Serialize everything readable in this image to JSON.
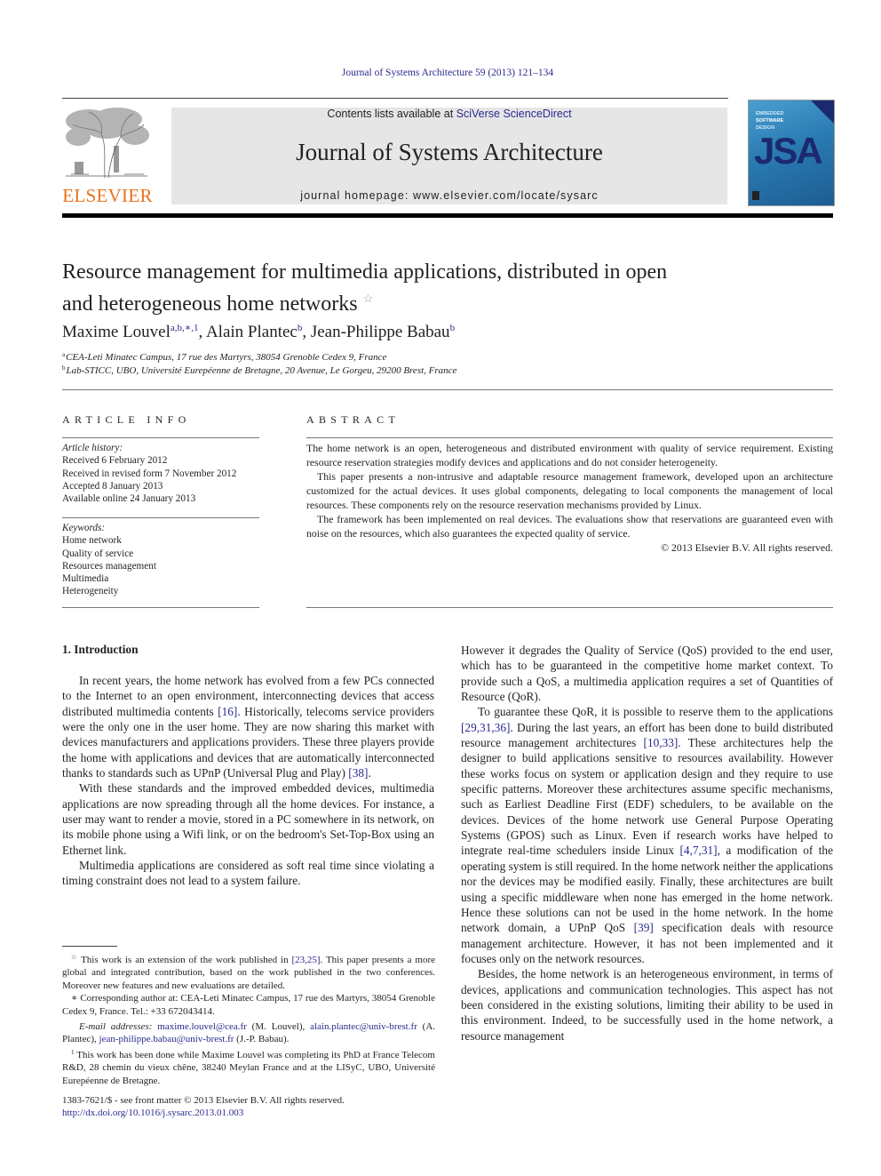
{
  "journal_ref": "Journal of Systems Architecture 59 (2013) 121–134",
  "publisher": {
    "name": "ELSEVIER",
    "brand_color": "#e9711c"
  },
  "banner": {
    "contents_prefix": "Contents lists available at ",
    "contents_link": "SciVerse ScienceDirect",
    "journal_title": "Journal of Systems Architecture",
    "homepage": "journal homepage: www.elsevier.com/locate/sysarc"
  },
  "cover": {
    "line1": "EMBEDDED",
    "line2": "SOFTWARE",
    "line3": "DESIGN",
    "acronym": "JSA"
  },
  "article": {
    "title_line1": "Resource management for multimedia applications, distributed in open",
    "title_line2": "and heterogeneous home networks",
    "title_mark": "☆",
    "authors": [
      {
        "name": "Maxime Louvel",
        "marks": "a,b,∗,1"
      },
      {
        "name": "Alain Plantec",
        "marks": "b"
      },
      {
        "name": "Jean-Philippe Babau",
        "marks": "b"
      }
    ],
    "affiliations": [
      {
        "mark": "a",
        "text": "CEA-Leti Minatec Campus, 17 rue des Martyrs, 38054 Grenoble Cedex 9, France"
      },
      {
        "mark": "b",
        "text": "Lab-STICC, UBO, Université Eurepéenne de Bretagne, 20 Avenue, Le Gorgeu, 29200 Brest, France"
      }
    ]
  },
  "article_info": {
    "heading": "ARTICLE INFO",
    "history_label": "Article history:",
    "history": [
      "Received 6 February 2012",
      "Received in revised form 7 November 2012",
      "Accepted 8 January 2013",
      "Available online 24 January 2013"
    ],
    "keywords_label": "Keywords:",
    "keywords": [
      "Home network",
      "Quality of service",
      "Resources management",
      "Multimedia",
      "Heterogeneity"
    ]
  },
  "abstract": {
    "heading": "ABSTRACT",
    "paragraphs": [
      "The home network is an open, heterogeneous and distributed environment with quality of service requirement. Existing resource reservation strategies modify devices and applications and do not consider heterogeneity.",
      "This paper presents a non-intrusive and adaptable resource management framework, developed upon an architecture customized for the actual devices. It uses global components, delegating to local components the management of local resources. These components rely on the resource reservation mechanisms provided by Linux.",
      "The framework has been implemented on real devices. The evaluations show that reservations are guaranteed even with noise on the resources, which also guarantees the expected quality of service."
    ],
    "copyright": "© 2013 Elsevier B.V. All rights reserved."
  },
  "intro": {
    "heading": "1. Introduction",
    "left": {
      "p1a": "In recent years, the home network has evolved from a few PCs connected to the Internet to an open environment, interconnecting devices that access distributed multimedia contents ",
      "p1_ref1": "[16]",
      "p1b": ". Historically, telecoms service providers were the only one in the user home. They are now sharing this market with devices manufacturers and applications providers. These three players provide the home with applications and devices that are automatically interconnected thanks to standards such as UPnP (Universal Plug and Play) ",
      "p1_ref2": "[38]",
      "p1c": ".",
      "p2": "With these standards and the improved embedded devices, multimedia applications are now spreading through all the home devices. For instance, a user may want to render a movie, stored in a PC somewhere in its network, on its mobile phone using a Wifi link, or on the bedroom's Set-Top-Box using an Ethernet link.",
      "p3": "Multimedia applications are considered as soft real time since violating a timing constraint does not lead to a system failure."
    },
    "right": {
      "p1": "However it degrades the Quality of Service (QoS) provided to the end user, which has to be guaranteed in the competitive home market context. To provide such a QoS, a multimedia application requires a set of Quantities of Resource (QoR).",
      "p2a": "To guarantee these QoR, it is possible to reserve them to the applications ",
      "p2_ref1": "[29,31,36]",
      "p2b": ". During the last years, an effort has been done to build distributed resource management architectures ",
      "p2_ref2": "[10,33]",
      "p2c": ". These architectures help the designer to build applications sensitive to resources availability. However these works focus on system or application design and they require to use specific patterns. Moreover these architectures assume specific mechanisms, such as Earliest Deadline First (EDF) schedulers, to be available on the devices. Devices of the home network use General Purpose Operating Systems (GPOS) such as Linux. Even if research works have helped to integrate real-time schedulers inside Linux ",
      "p2_ref3": "[4,7,31]",
      "p2d": ", a modification of the operating system is still required. In the home network neither the applications nor the devices may be modified easily. Finally, these architectures are built using a specific middleware when none has emerged in the home network. Hence these solutions can not be used in the home network. In the home network domain, a UPnP QoS ",
      "p2_ref4": "[39]",
      "p2e": " specification deals with resource management architecture. However, it has not been implemented and it focuses only on the network resources.",
      "p3": "Besides, the home network is an heterogeneous environment, in terms of devices, applications and communication technologies. This aspect has not been considered in the existing solutions, limiting their ability to be used in this environment. Indeed, to be successfully used in the home network, a resource management"
    }
  },
  "footnotes": {
    "star_mark": "☆",
    "star_a": " This work is an extension of the work published in ",
    "star_ref": "[23,25]",
    "star_b": ". This paper presents a more global and integrated contribution, based on the work published in the two conferences. Moreover new features and new evaluations are detailed.",
    "corr_mark": "∗",
    "corr": " Corresponding author at: CEA-Leti Minatec Campus, 17 rue des Martyrs, 38054 Grenoble Cedex 9, France. Tel.: +33 672043414.",
    "email_label": "E-mail addresses:",
    "emails": [
      {
        "address": "maxime.louvel@cea.fr",
        "who": " (M. Louvel), "
      },
      {
        "address": "alain.plantec@univ-brest.fr",
        "who": " (A. Plantec), "
      },
      {
        "address": "jean-philippe.babau@univ-brest.fr",
        "who": " (J.-P. Babau)."
      }
    ],
    "one_mark": "1",
    "one": " This work has been done while Maxime Louvel was completing its PhD at France Telecom R&D, 28 chemin du vieux chêne, 38240 Meylan France and at the LISyC, UBO, Université Eurepéenne de Bretagne."
  },
  "footer": {
    "issn_line": "1383-7621/$ - see front matter © 2013 Elsevier B.V. All rights reserved.",
    "doi": "http://dx.doi.org/10.1016/j.sysarc.2013.01.003"
  }
}
